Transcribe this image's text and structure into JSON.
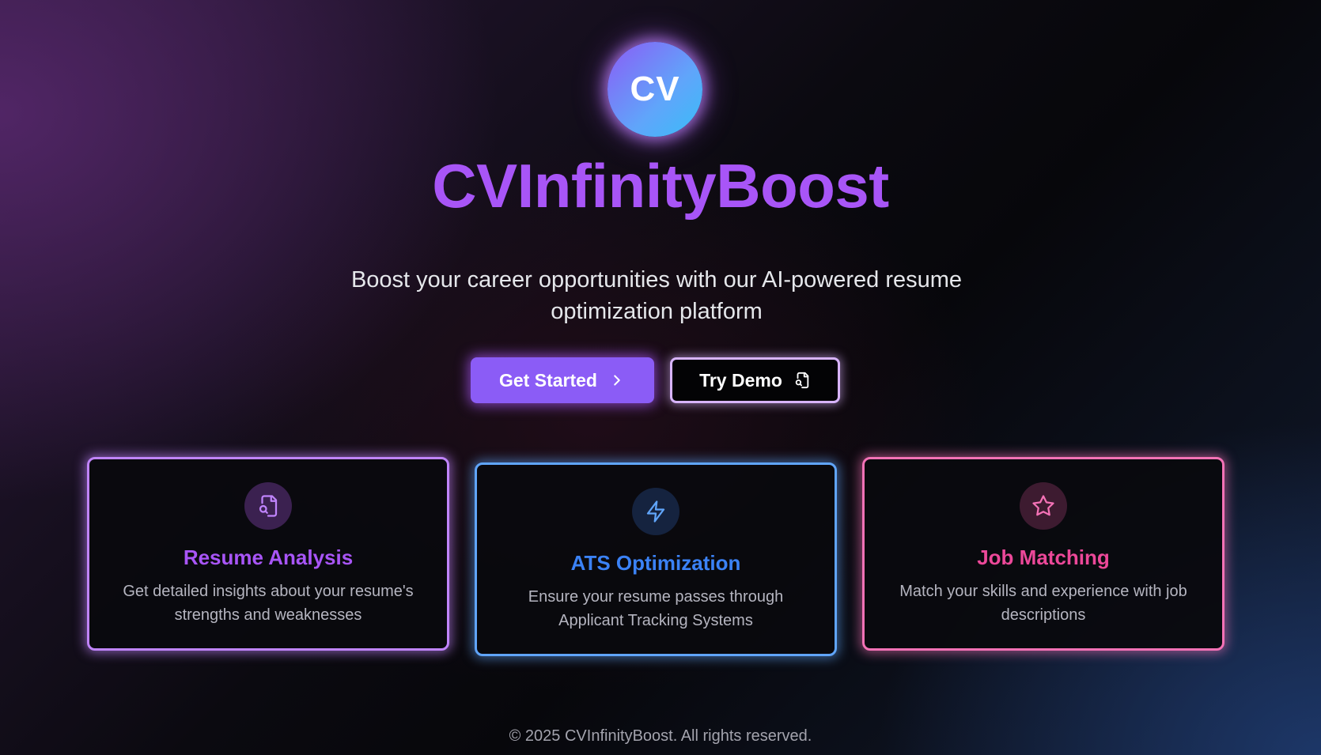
{
  "logo": {
    "text": "CV"
  },
  "hero": {
    "title": "CVInfinityBoost",
    "subtitle": "Boost your career opportunities with our AI-powered resume optimization platform"
  },
  "actions": {
    "get_started": {
      "label": "Get Started",
      "icon": "chevron-right-icon"
    },
    "try_demo": {
      "label": "Try Demo",
      "icon": "file-search-icon"
    }
  },
  "features": [
    {
      "title": "Resume Analysis",
      "description": "Get detailed insights about your resume's strengths and weaknesses",
      "icon": "file-search-icon",
      "accent": "#a855f7"
    },
    {
      "title": "ATS Optimization",
      "description": "Ensure your resume passes through Applicant Tracking Systems",
      "icon": "lightning-icon",
      "accent": "#3b82f6"
    },
    {
      "title": "Job Matching",
      "description": "Match your skills and experience with job descriptions",
      "icon": "star-icon",
      "accent": "#ec4899"
    }
  ],
  "footer": {
    "text": "© 2025 CVInfinityBoost. All rights reserved."
  },
  "colors": {
    "brand_purple": "#a855f7",
    "button_purple": "#8b5cf6",
    "accent_blue": "#3b82f6",
    "accent_pink": "#ec4899"
  }
}
